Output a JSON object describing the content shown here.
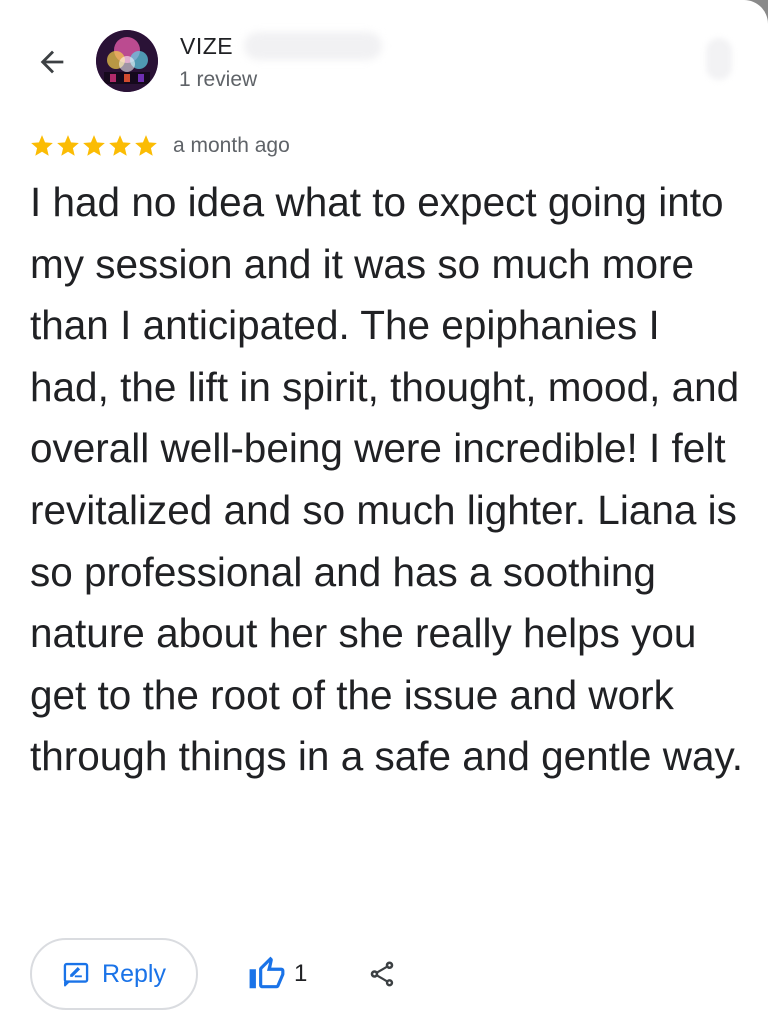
{
  "reviewer": {
    "name": "VIZE",
    "review_count": "1 review"
  },
  "icons": {
    "back": "arrow-left-icon",
    "avatar": "avatar-image",
    "star": "star-icon",
    "reply": "reply-edit-icon",
    "like": "thumbs-up-icon",
    "share": "share-icon"
  },
  "review": {
    "rating": 5,
    "date": "a month ago",
    "text": "I had no idea what to expect going into my session and it was so much more than I anticipated. The epiphanies I had, the lift in spirit, thought, mood, and overall well-being were incredible! I felt revitalized and so much lighter. Liana is so professional and has a soothing nature about her she really helps you get to the root of the issue and work through things in a safe and gentle way."
  },
  "actions": {
    "reply_label": "Reply",
    "like_count": "1"
  },
  "colors": {
    "star": "#fbbc04",
    "accent": "#1a73e8",
    "text": "#202124",
    "secondary_text": "#5f6368",
    "border": "#dadce0"
  }
}
